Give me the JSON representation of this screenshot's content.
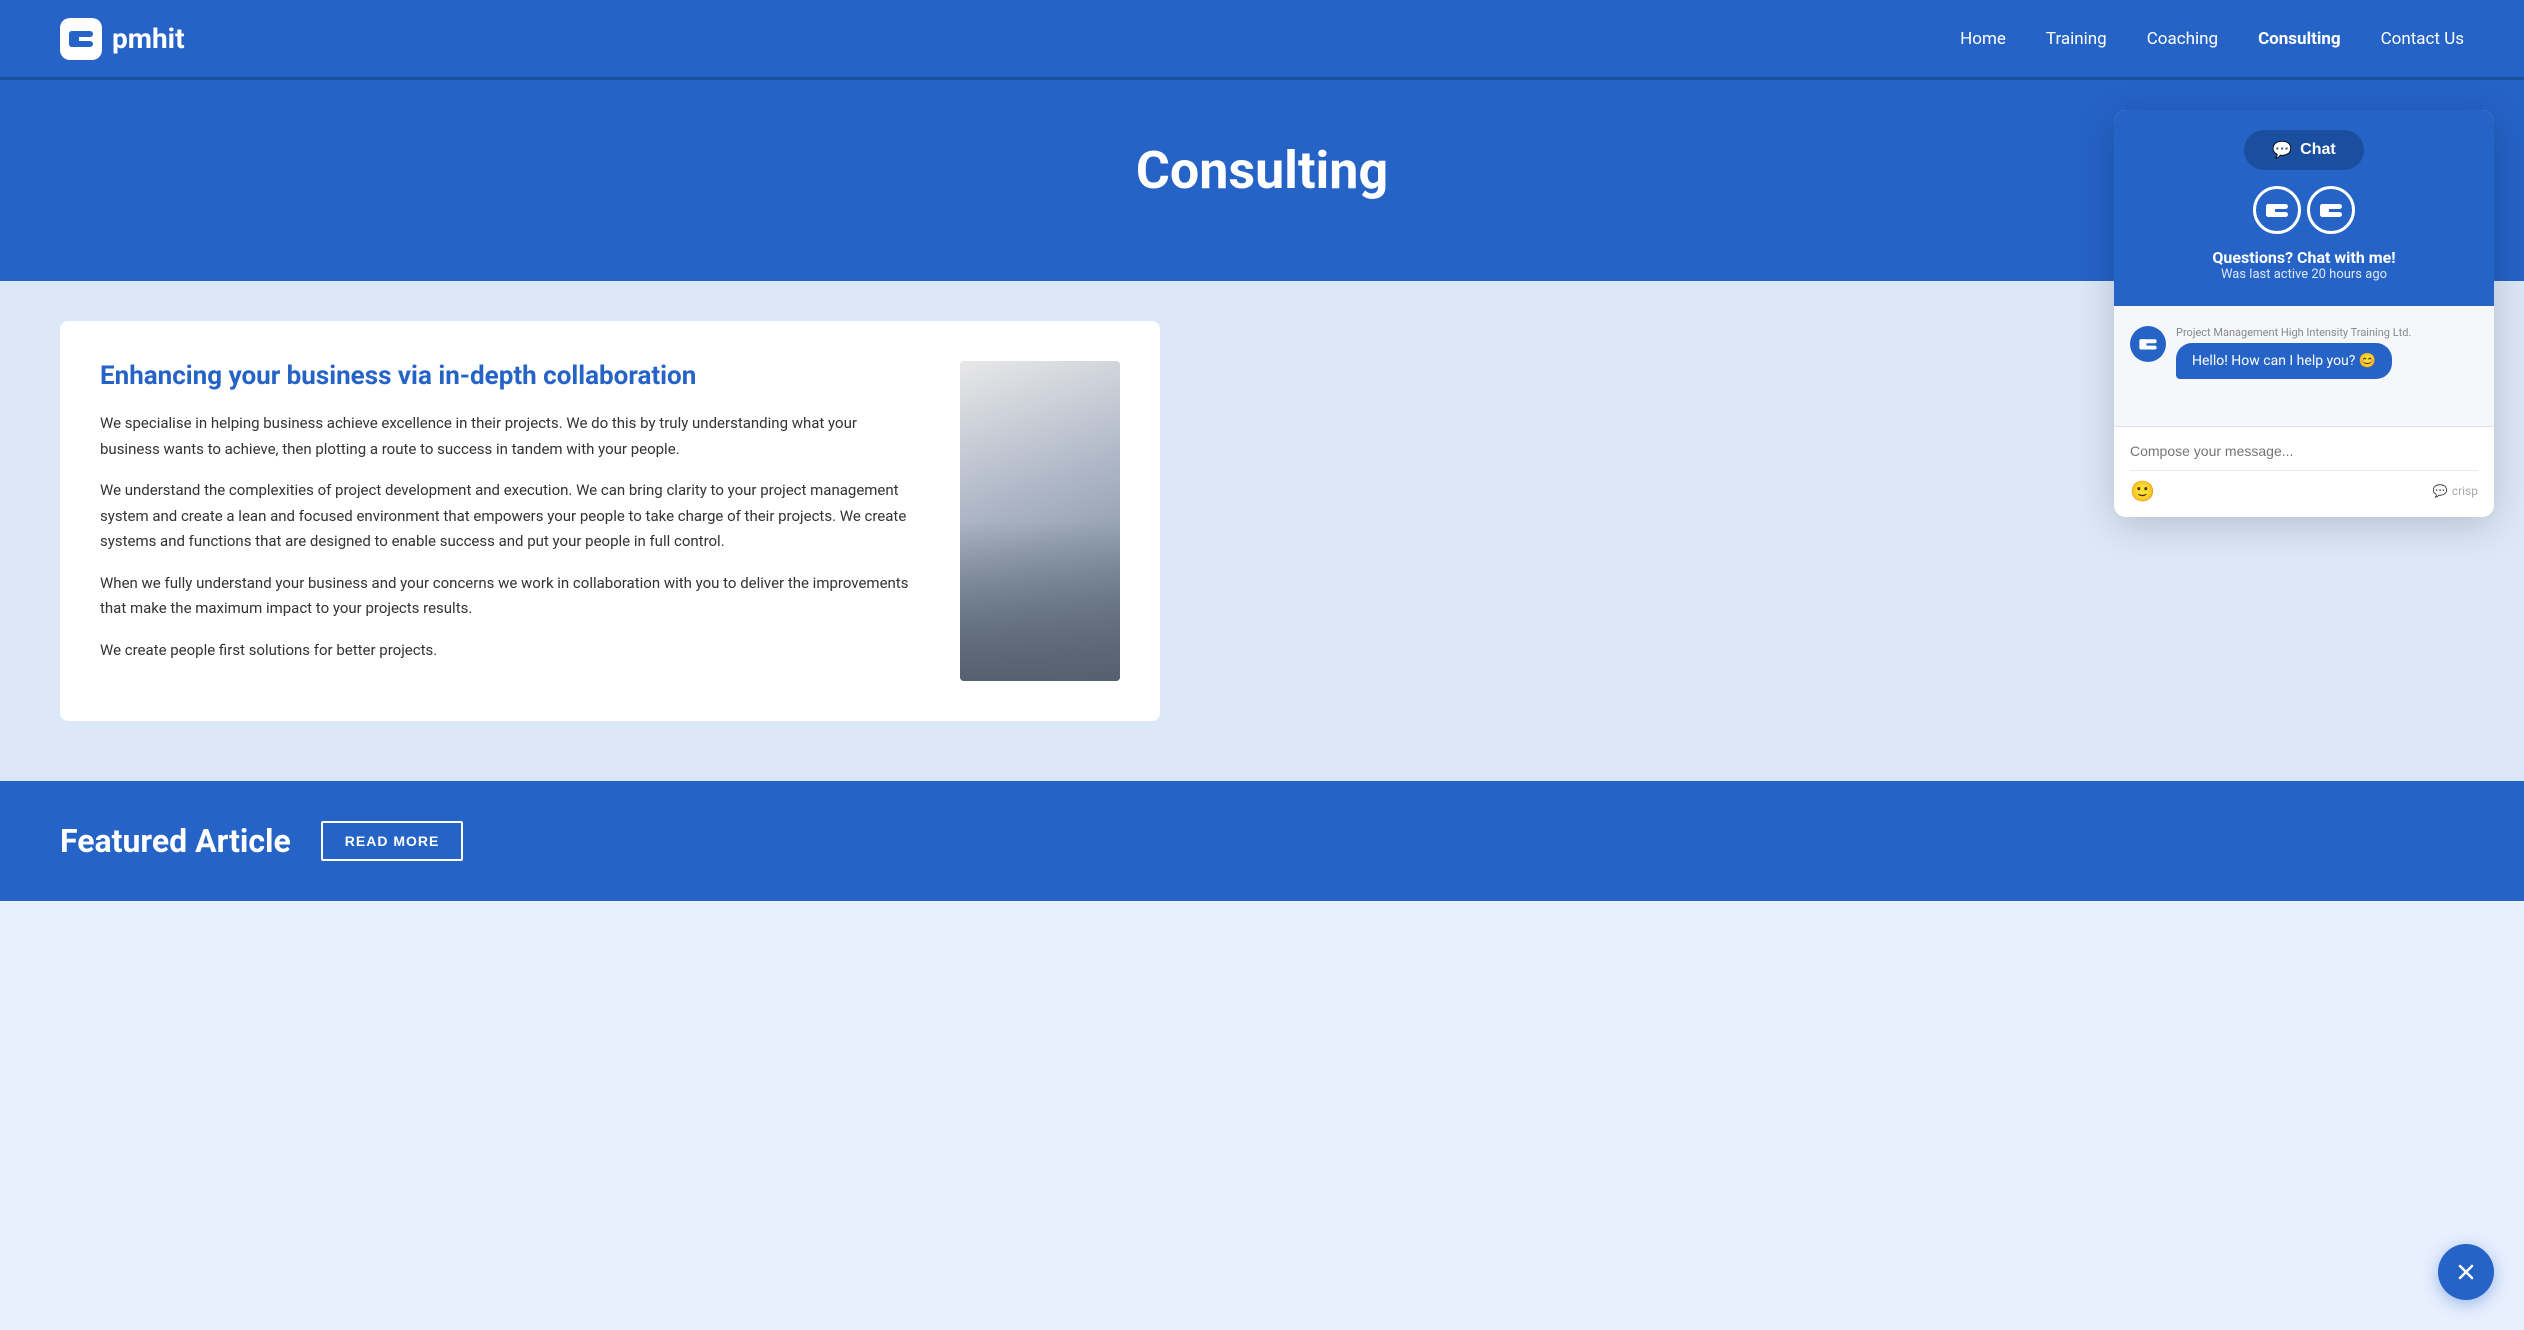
{
  "header": {
    "logo_text": "pmhit",
    "nav": [
      {
        "label": "Home",
        "active": false
      },
      {
        "label": "Training",
        "active": false
      },
      {
        "label": "Coaching",
        "active": false
      },
      {
        "label": "Consulting",
        "active": true
      },
      {
        "label": "Contact Us",
        "active": false
      }
    ]
  },
  "page_title": "Consulting",
  "content_card": {
    "heading": "Enhancing your business via in-depth collaboration",
    "paragraphs": [
      "We specialise in helping business achieve excellence in their projects. We do this by truly understanding what your business wants to achieve, then plotting a route to success in tandem with your people.",
      "We understand the complexities of project development and execution. We can bring clarity to your project management system and create a lean and focused environment that empowers your people to take charge of their projects. We create systems and functions that are designed to enable success and put your people in full control.",
      "When we fully understand your business and your concerns we work in collaboration with you to deliver the improvements that make the maximum impact to your projects results.",
      "We create people first solutions for better projects."
    ]
  },
  "featured_section": {
    "title": "Featured Article",
    "button_label": "READ MORE"
  },
  "chat_widget": {
    "chat_button_label": "Chat",
    "agent_name": "Questions? Chat with me!",
    "agent_status": "Was last active 20 hours ago",
    "sender_name": "Project Management High Intensity Training Ltd.",
    "message": "Hello! How can I help you? 😊",
    "input_placeholder": "Compose your message...",
    "crisp_label": "crisp"
  }
}
